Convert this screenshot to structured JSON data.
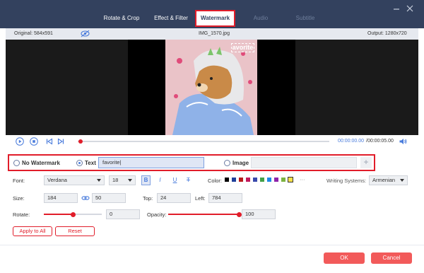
{
  "header": {
    "tabs": [
      {
        "label": "Rotate & Crop",
        "state": "enabled"
      },
      {
        "label": "Effect & Filter",
        "state": "enabled"
      },
      {
        "label": "Watermark",
        "state": "active"
      },
      {
        "label": "Audio",
        "state": "disabled"
      },
      {
        "label": "Subtitle",
        "state": "disabled"
      }
    ],
    "window_controls": [
      "minimize-icon",
      "close-icon"
    ]
  },
  "preview": {
    "original": "Original: 584x591",
    "filename": "IMG_1570.jpg",
    "output": "Output: 1280x720",
    "watermark_text": "avorite",
    "toggle_icon": "eye-icon"
  },
  "playback": {
    "current": "00:00:00.00",
    "total": "/00:00:05.00",
    "progress": 0.0,
    "icons": [
      "play-icon",
      "stop-icon",
      "previous-icon",
      "next-icon",
      "volume-icon"
    ]
  },
  "watermark": {
    "no_watermark_label": "No Watermark",
    "text_label": "Text",
    "text_value": "favorite",
    "image_label": "Image",
    "selected": "Text",
    "add_icon": "+"
  },
  "font": {
    "font_label": "Font:",
    "family": "Verdana",
    "size": "18",
    "format": [
      "B",
      "I",
      "U",
      "T"
    ],
    "color_label": "Color:",
    "colors": [
      "#000000",
      "#1f3f9a",
      "#b71c1c",
      "#c2185b",
      "#3949ab",
      "#43a047",
      "#1e88e5",
      "#8e24aa",
      "#7cb342",
      "#f9e04b"
    ],
    "more": "···",
    "writing_label": "Writing Systems:",
    "writing_value": "Armenian"
  },
  "geometry_fields": {
    "size_label": "Size:",
    "width": "184",
    "height": "50",
    "top_label": "Top:",
    "top": "24",
    "left_label": "Left:",
    "left": "784"
  },
  "rotate": {
    "label": "Rotate:",
    "value": "0",
    "level": 0.5
  },
  "opacity": {
    "label": "Opacity:",
    "value": "100",
    "level": 1.0
  },
  "actions": {
    "apply_all": "Apply to All",
    "reset": "Reset",
    "ok": "OK",
    "cancel": "Cancel"
  },
  "colors": {
    "header_bg": "#33415e",
    "accent_red": "#e11d2a",
    "accent_blue": "#4a7cdc",
    "button_red": "#f25a5a"
  }
}
